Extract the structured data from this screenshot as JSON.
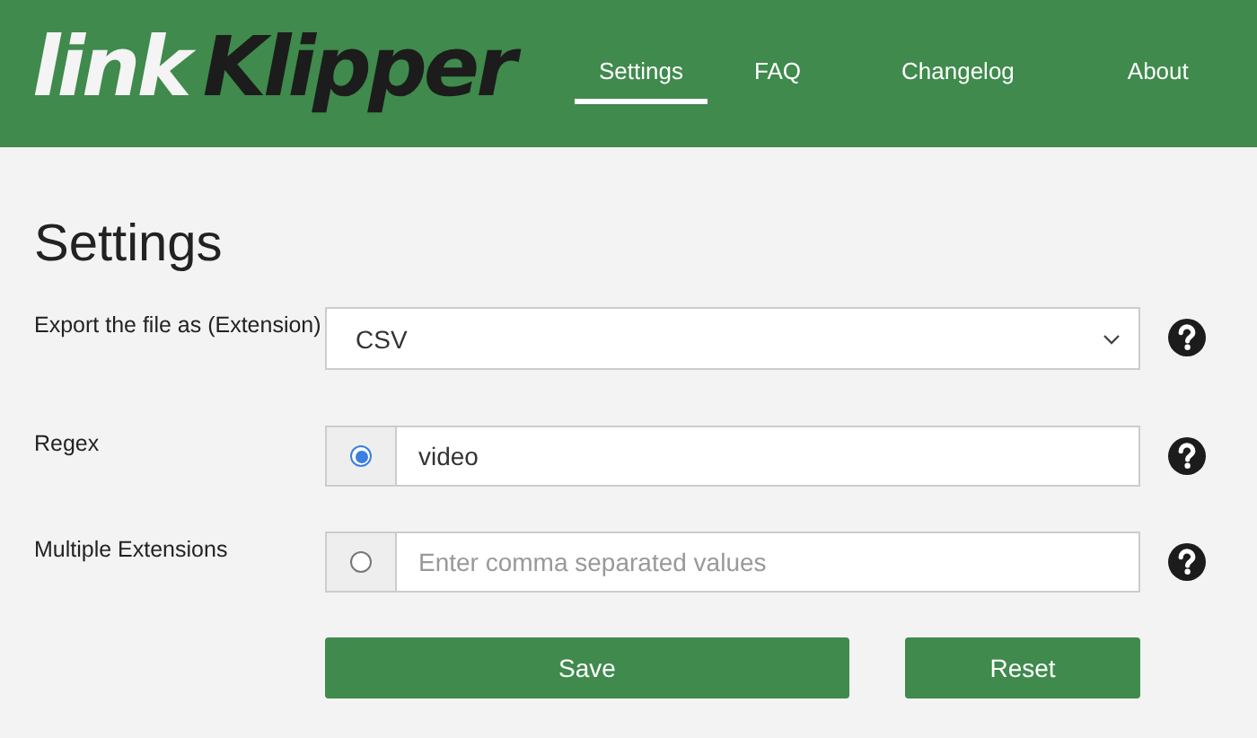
{
  "logo": {
    "light": "link",
    "dark": "Klipper"
  },
  "nav": [
    {
      "label": "Settings",
      "selected": true
    },
    {
      "label": "FAQ",
      "selected": false
    },
    {
      "label": "Changelog",
      "selected": false
    },
    {
      "label": "About",
      "selected": false
    }
  ],
  "title": "Settings",
  "rows": [
    {
      "label": "Export the file as (Extension)",
      "kind": "select",
      "value": "CSV"
    },
    {
      "label": "Regex",
      "kind": "radio-input",
      "selected": true,
      "value": "video"
    },
    {
      "label": "Multiple Extensions",
      "kind": "radio-input",
      "selected": false,
      "placeholder": "Enter comma separated values"
    }
  ],
  "buttons": [
    {
      "label": "Save",
      "kind": "wide"
    },
    {
      "label": "Reset",
      "kind": "narrow"
    }
  ]
}
